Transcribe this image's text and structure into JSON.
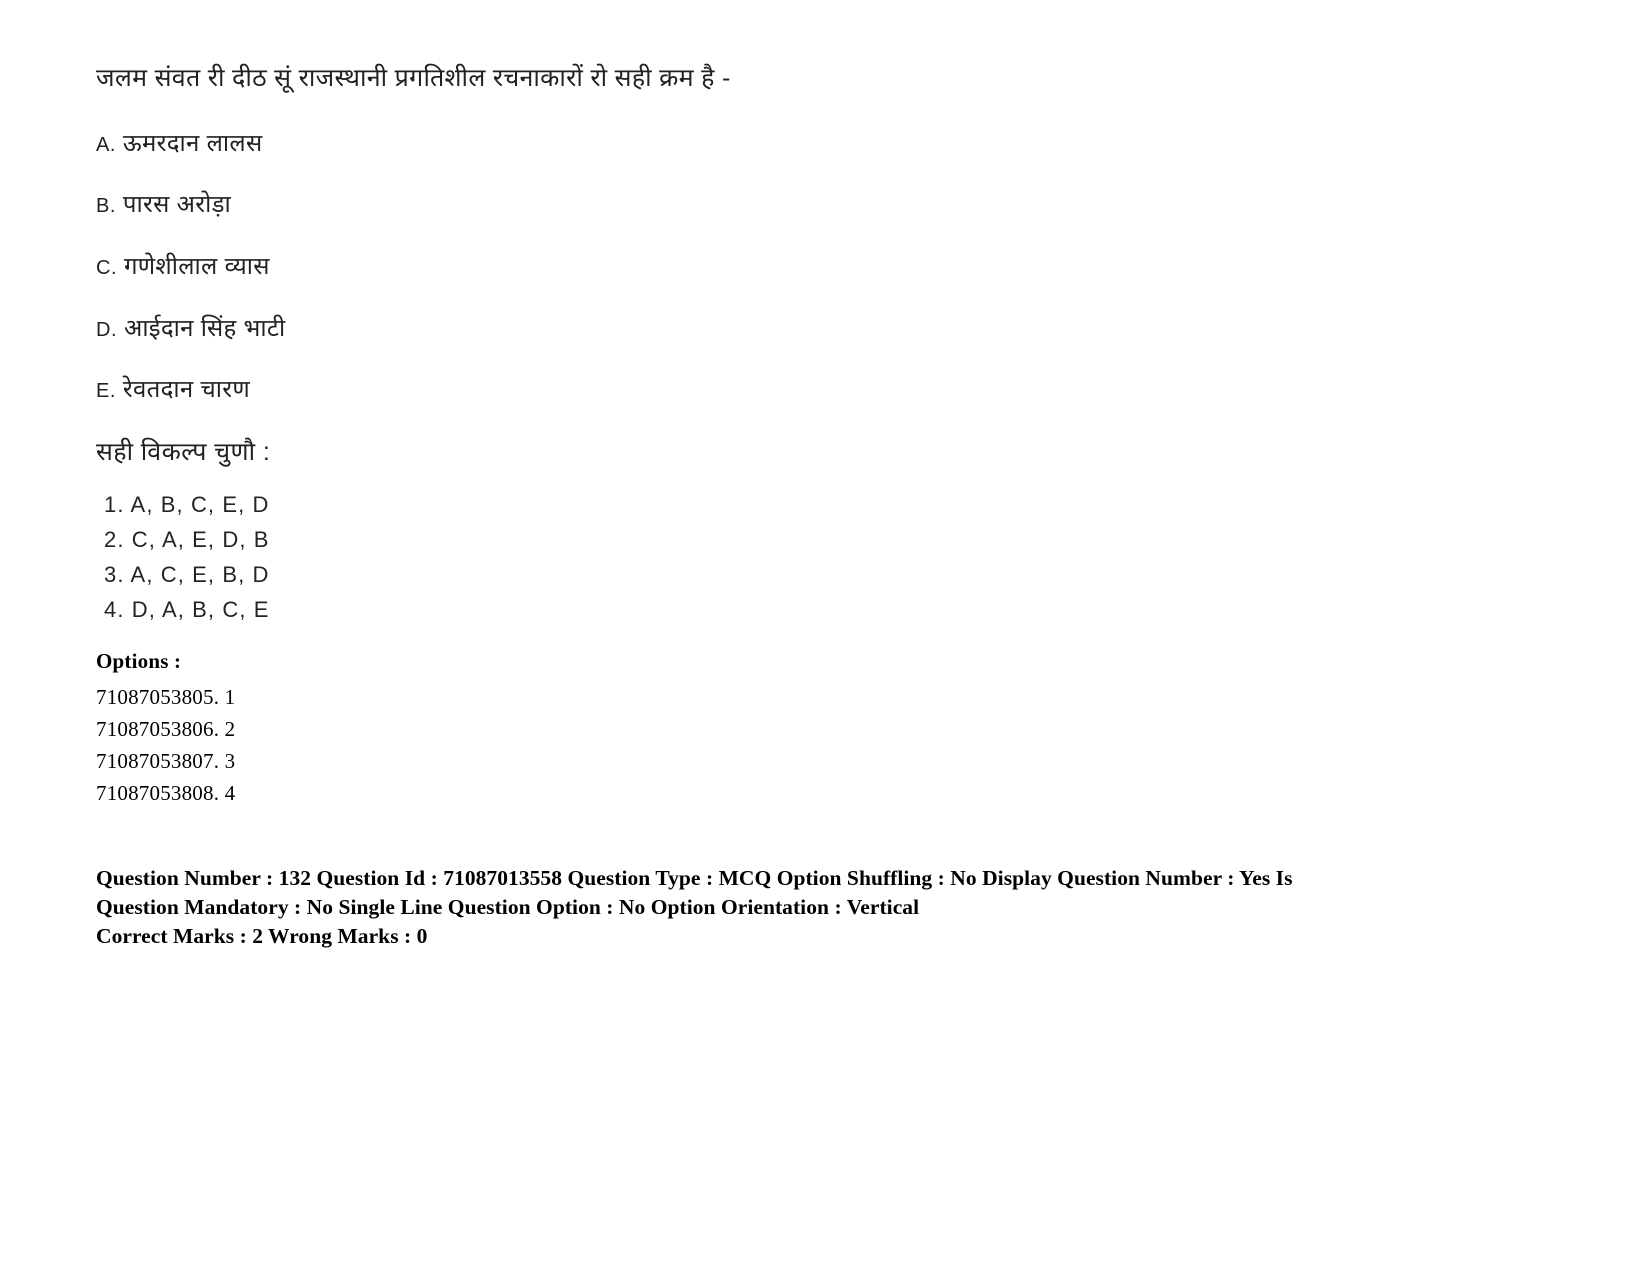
{
  "question": {
    "stem": "जलम संवत री दीठ सूं राजस्थानी प्रगतिशील रचनाकारों रो सही क्रम है -",
    "items": [
      {
        "label": "A.",
        "text": "ऊमरदान लालस"
      },
      {
        "label": "B.",
        "text": "पारस अरोड़ा"
      },
      {
        "label": "C.",
        "text": "गणेशीलाल व्यास"
      },
      {
        "label": "D.",
        "text": "आईदान सिंह भाटी"
      },
      {
        "label": "E.",
        "text": "रेवतदान चारण"
      }
    ],
    "choose_prompt": "सही विकल्प चुणौ :",
    "alternatives": [
      "1. A, B, C, E, D",
      "2. C, A, E, D, B",
      "3. A, C, E, B, D",
      "4. D, A, B, C, E"
    ]
  },
  "options": {
    "heading": "Options :",
    "entries": [
      "71087053805. 1",
      "71087053806. 2",
      "71087053807. 3",
      "71087053808. 4"
    ]
  },
  "metadata": {
    "line1": "Question Number : 132 Question Id : 71087013558 Question Type : MCQ Option Shuffling : No Display Question Number : Yes Is",
    "line2": "Question Mandatory : No Single Line Question Option : No Option Orientation : Vertical",
    "line3": "Correct Marks : 2 Wrong Marks : 0"
  }
}
